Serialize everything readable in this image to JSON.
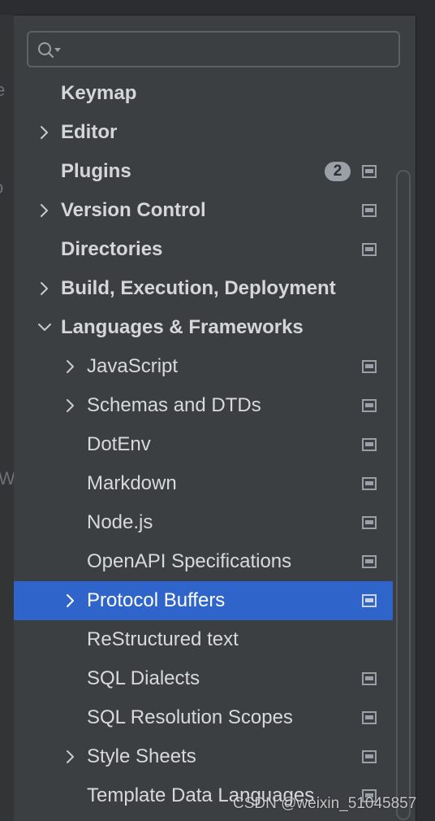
{
  "search": {
    "placeholder": ""
  },
  "backdrop": {
    "glyphs": [
      "e",
      "o",
      "W"
    ]
  },
  "tree": {
    "items": [
      {
        "label": "Keymap",
        "level": 0,
        "chevron": "none",
        "badge": "",
        "project_icon": false,
        "selected": false
      },
      {
        "label": "Editor",
        "level": 0,
        "chevron": "right",
        "badge": "",
        "project_icon": false,
        "selected": false
      },
      {
        "label": "Plugins",
        "level": 0,
        "chevron": "none",
        "badge": "2",
        "project_icon": true,
        "selected": false
      },
      {
        "label": "Version Control",
        "level": 0,
        "chevron": "right",
        "badge": "",
        "project_icon": true,
        "selected": false
      },
      {
        "label": "Directories",
        "level": 0,
        "chevron": "none",
        "badge": "",
        "project_icon": true,
        "selected": false
      },
      {
        "label": "Build, Execution, Deployment",
        "level": 0,
        "chevron": "right",
        "badge": "",
        "project_icon": false,
        "selected": false
      },
      {
        "label": "Languages & Frameworks",
        "level": 0,
        "chevron": "down",
        "badge": "",
        "project_icon": false,
        "selected": false
      },
      {
        "label": "JavaScript",
        "level": 1,
        "chevron": "right",
        "badge": "",
        "project_icon": true,
        "selected": false
      },
      {
        "label": "Schemas and DTDs",
        "level": 1,
        "chevron": "right",
        "badge": "",
        "project_icon": true,
        "selected": false
      },
      {
        "label": "DotEnv",
        "level": 1,
        "chevron": "none",
        "badge": "",
        "project_icon": true,
        "selected": false
      },
      {
        "label": "Markdown",
        "level": 1,
        "chevron": "none",
        "badge": "",
        "project_icon": true,
        "selected": false
      },
      {
        "label": "Node.js",
        "level": 1,
        "chevron": "none",
        "badge": "",
        "project_icon": true,
        "selected": false
      },
      {
        "label": "OpenAPI Specifications",
        "level": 1,
        "chevron": "none",
        "badge": "",
        "project_icon": true,
        "selected": false
      },
      {
        "label": "Protocol Buffers",
        "level": 1,
        "chevron": "right",
        "badge": "",
        "project_icon": true,
        "selected": true
      },
      {
        "label": "ReStructured text",
        "level": 1,
        "chevron": "none",
        "badge": "",
        "project_icon": false,
        "selected": false
      },
      {
        "label": "SQL Dialects",
        "level": 1,
        "chevron": "none",
        "badge": "",
        "project_icon": true,
        "selected": false
      },
      {
        "label": "SQL Resolution Scopes",
        "level": 1,
        "chevron": "none",
        "badge": "",
        "project_icon": true,
        "selected": false
      },
      {
        "label": "Style Sheets",
        "level": 1,
        "chevron": "right",
        "badge": "",
        "project_icon": true,
        "selected": false
      },
      {
        "label": "Template Data Languages",
        "level": 1,
        "chevron": "none",
        "badge": "",
        "project_icon": true,
        "selected": false
      }
    ]
  },
  "watermark": "CSDN @weixin_51045857",
  "colors": {
    "panel_bg": "#3c3f41",
    "selection": "#2f65ca",
    "text": "#dfe1e5",
    "icon": "#9aa0a6"
  }
}
